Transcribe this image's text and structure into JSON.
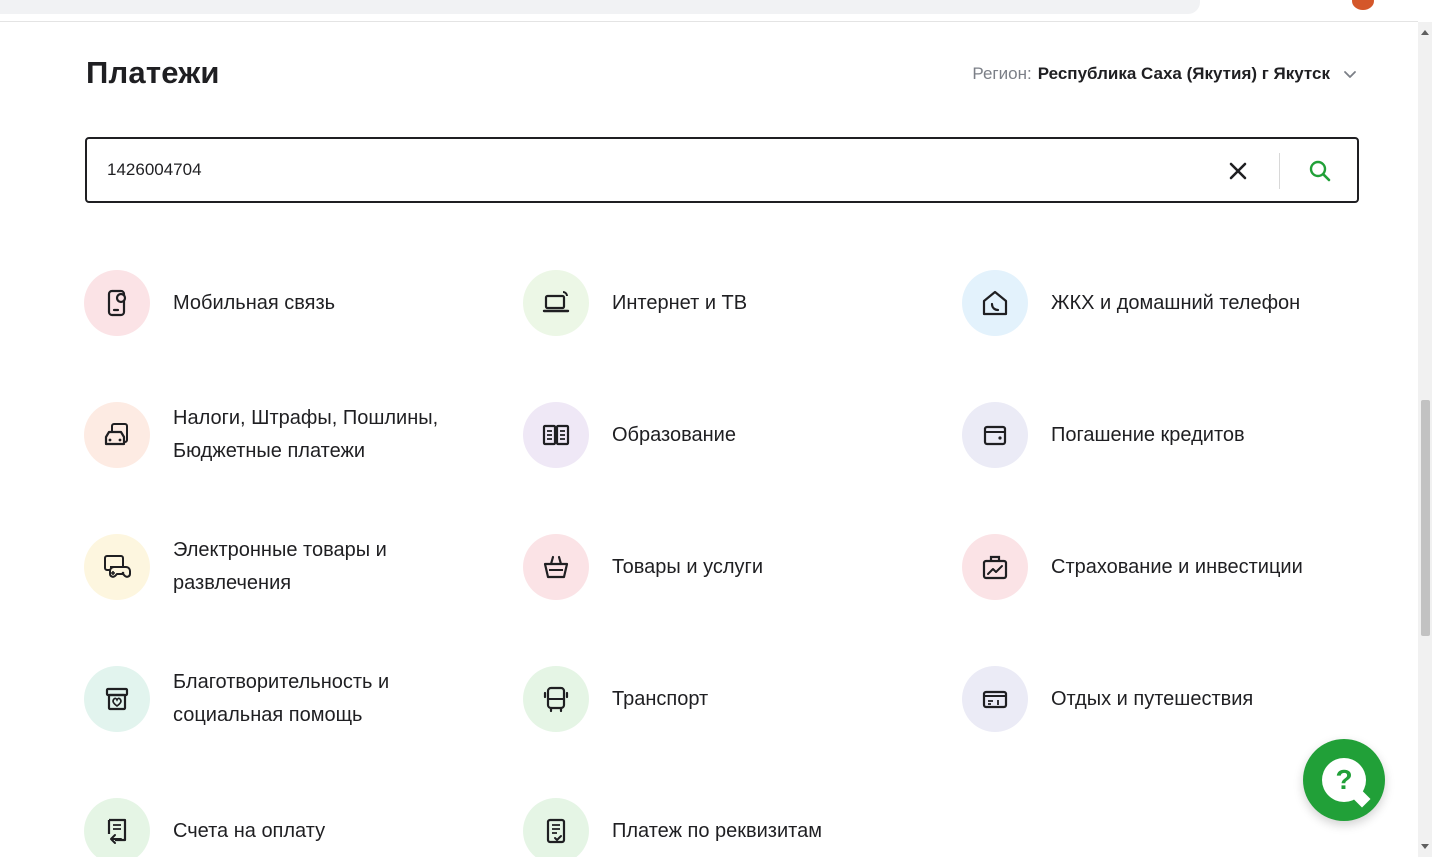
{
  "page": {
    "title": "Платежи"
  },
  "region": {
    "label": "Регион:",
    "value": "Республика Саха (Якутия) г Якутск",
    "icon": "chevron-down-icon"
  },
  "search": {
    "value": "1426004704",
    "clear_icon": "close-icon",
    "search_icon": "search-icon"
  },
  "categories": [
    {
      "label": "Мобильная связь",
      "icon": "mobile-phone-icon",
      "bg": "#fbe3e6"
    },
    {
      "label": "Интернет и ТВ",
      "icon": "laptop-wifi-icon",
      "bg": "#ecf7e6"
    },
    {
      "label": "ЖКХ и домашний телефон",
      "icon": "house-phone-icon",
      "bg": "#e3f2fc"
    },
    {
      "label": "Налоги, Штрафы, Пошлины, Бюджетные платежи",
      "icon": "car-document-icon",
      "bg": "#fdebe3"
    },
    {
      "label": "Образование",
      "icon": "open-book-icon",
      "bg": "#efe8f6"
    },
    {
      "label": "Погашение кредитов",
      "icon": "wallet-icon",
      "bg": "#ebebf6"
    },
    {
      "label": "Электронные товары и развлечения",
      "icon": "gamepad-icon",
      "bg": "#fdf6df"
    },
    {
      "label": "Товары и услуги",
      "icon": "shopping-basket-icon",
      "bg": "#fbe3e6"
    },
    {
      "label": "Страхование и инвестиции",
      "icon": "briefcase-chart-icon",
      "bg": "#fbe3e6"
    },
    {
      "label": "Благотворительность и социальная помощь",
      "icon": "donation-box-icon",
      "bg": "#e2f4ee"
    },
    {
      "label": "Транспорт",
      "icon": "bus-icon",
      "bg": "#e5f5e5"
    },
    {
      "label": "Отдых и путешествия",
      "icon": "ticket-icon",
      "bg": "#ebebf6"
    },
    {
      "label": "Счета на оплату",
      "icon": "invoice-icon",
      "bg": "#e5f5e5"
    },
    {
      "label": "Платеж по реквизитам",
      "icon": "document-check-icon",
      "bg": "#e5f5e5"
    }
  ],
  "help": {
    "label": "?",
    "icon": "help-chat-icon",
    "color": "#21a038"
  }
}
